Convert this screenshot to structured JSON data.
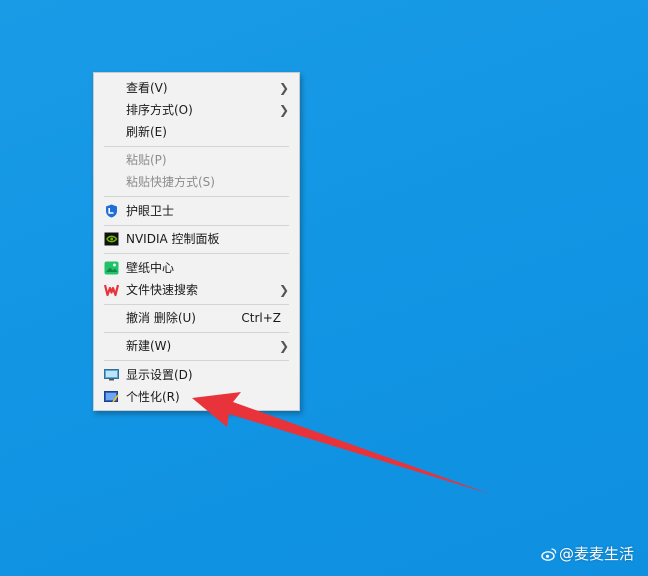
{
  "context_menu": {
    "items": [
      {
        "label": "查看(V)",
        "has_submenu": true
      },
      {
        "label": "排序方式(O)",
        "has_submenu": true
      },
      {
        "label": "刷新(E)"
      },
      {
        "label": "粘贴(P)",
        "disabled": true
      },
      {
        "label": "粘贴快捷方式(S)",
        "disabled": true
      },
      {
        "label": "护眼卫士",
        "icon": "shield-icon"
      },
      {
        "label": "NVIDIA 控制面板",
        "icon": "nvidia-icon"
      },
      {
        "label": "壁纸中心",
        "icon": "wallpaper-icon"
      },
      {
        "label": "文件快速搜索",
        "icon": "wps-icon",
        "has_submenu": true
      },
      {
        "label": "撤消 删除(U)",
        "shortcut": "Ctrl+Z"
      },
      {
        "label": "新建(W)",
        "has_submenu": true
      },
      {
        "label": "显示设置(D)",
        "icon": "display-icon"
      },
      {
        "label": "个性化(R)",
        "icon": "personalize-icon"
      }
    ]
  },
  "watermark": {
    "text": "@麦麦生活",
    "icon": "weibo-icon"
  },
  "colors": {
    "desktop": "#1296e4",
    "arrow": "#e8333a"
  }
}
